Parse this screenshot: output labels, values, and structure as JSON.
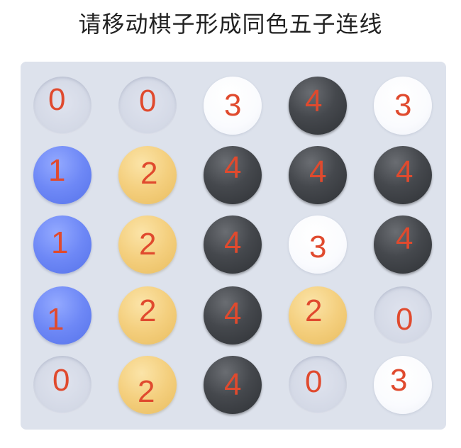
{
  "title": "请移动棋子形成同色五子连线",
  "colors": {
    "empty": "#d4d9e6",
    "blue": "#6e88f6",
    "yellow": "#f4cf7e",
    "black": "#45484d",
    "white": "#fafbfe",
    "number": "#e04a2e",
    "board": "#dde2ec"
  },
  "board": {
    "rows": [
      [
        {
          "value": "0",
          "color": "empty"
        },
        {
          "value": "0",
          "color": "empty"
        },
        {
          "value": "3",
          "color": "white"
        },
        {
          "value": "4",
          "color": "black"
        },
        {
          "value": "3",
          "color": "white"
        }
      ],
      [
        {
          "value": "1",
          "color": "blue"
        },
        {
          "value": "2",
          "color": "yellow"
        },
        {
          "value": "4",
          "color": "black"
        },
        {
          "value": "4",
          "color": "black"
        },
        {
          "value": "4",
          "color": "black"
        }
      ],
      [
        {
          "value": "1",
          "color": "blue"
        },
        {
          "value": "2",
          "color": "yellow"
        },
        {
          "value": "4",
          "color": "black"
        },
        {
          "value": "3",
          "color": "white"
        },
        {
          "value": "4",
          "color": "black"
        }
      ],
      [
        {
          "value": "1",
          "color": "blue"
        },
        {
          "value": "2",
          "color": "yellow"
        },
        {
          "value": "4",
          "color": "black"
        },
        {
          "value": "2",
          "color": "yellow"
        },
        {
          "value": "0",
          "color": "empty"
        }
      ],
      [
        {
          "value": "0",
          "color": "empty"
        },
        {
          "value": "2",
          "color": "yellow"
        },
        {
          "value": "4",
          "color": "black"
        },
        {
          "value": "0",
          "color": "empty"
        },
        {
          "value": "3",
          "color": "white"
        }
      ]
    ]
  }
}
